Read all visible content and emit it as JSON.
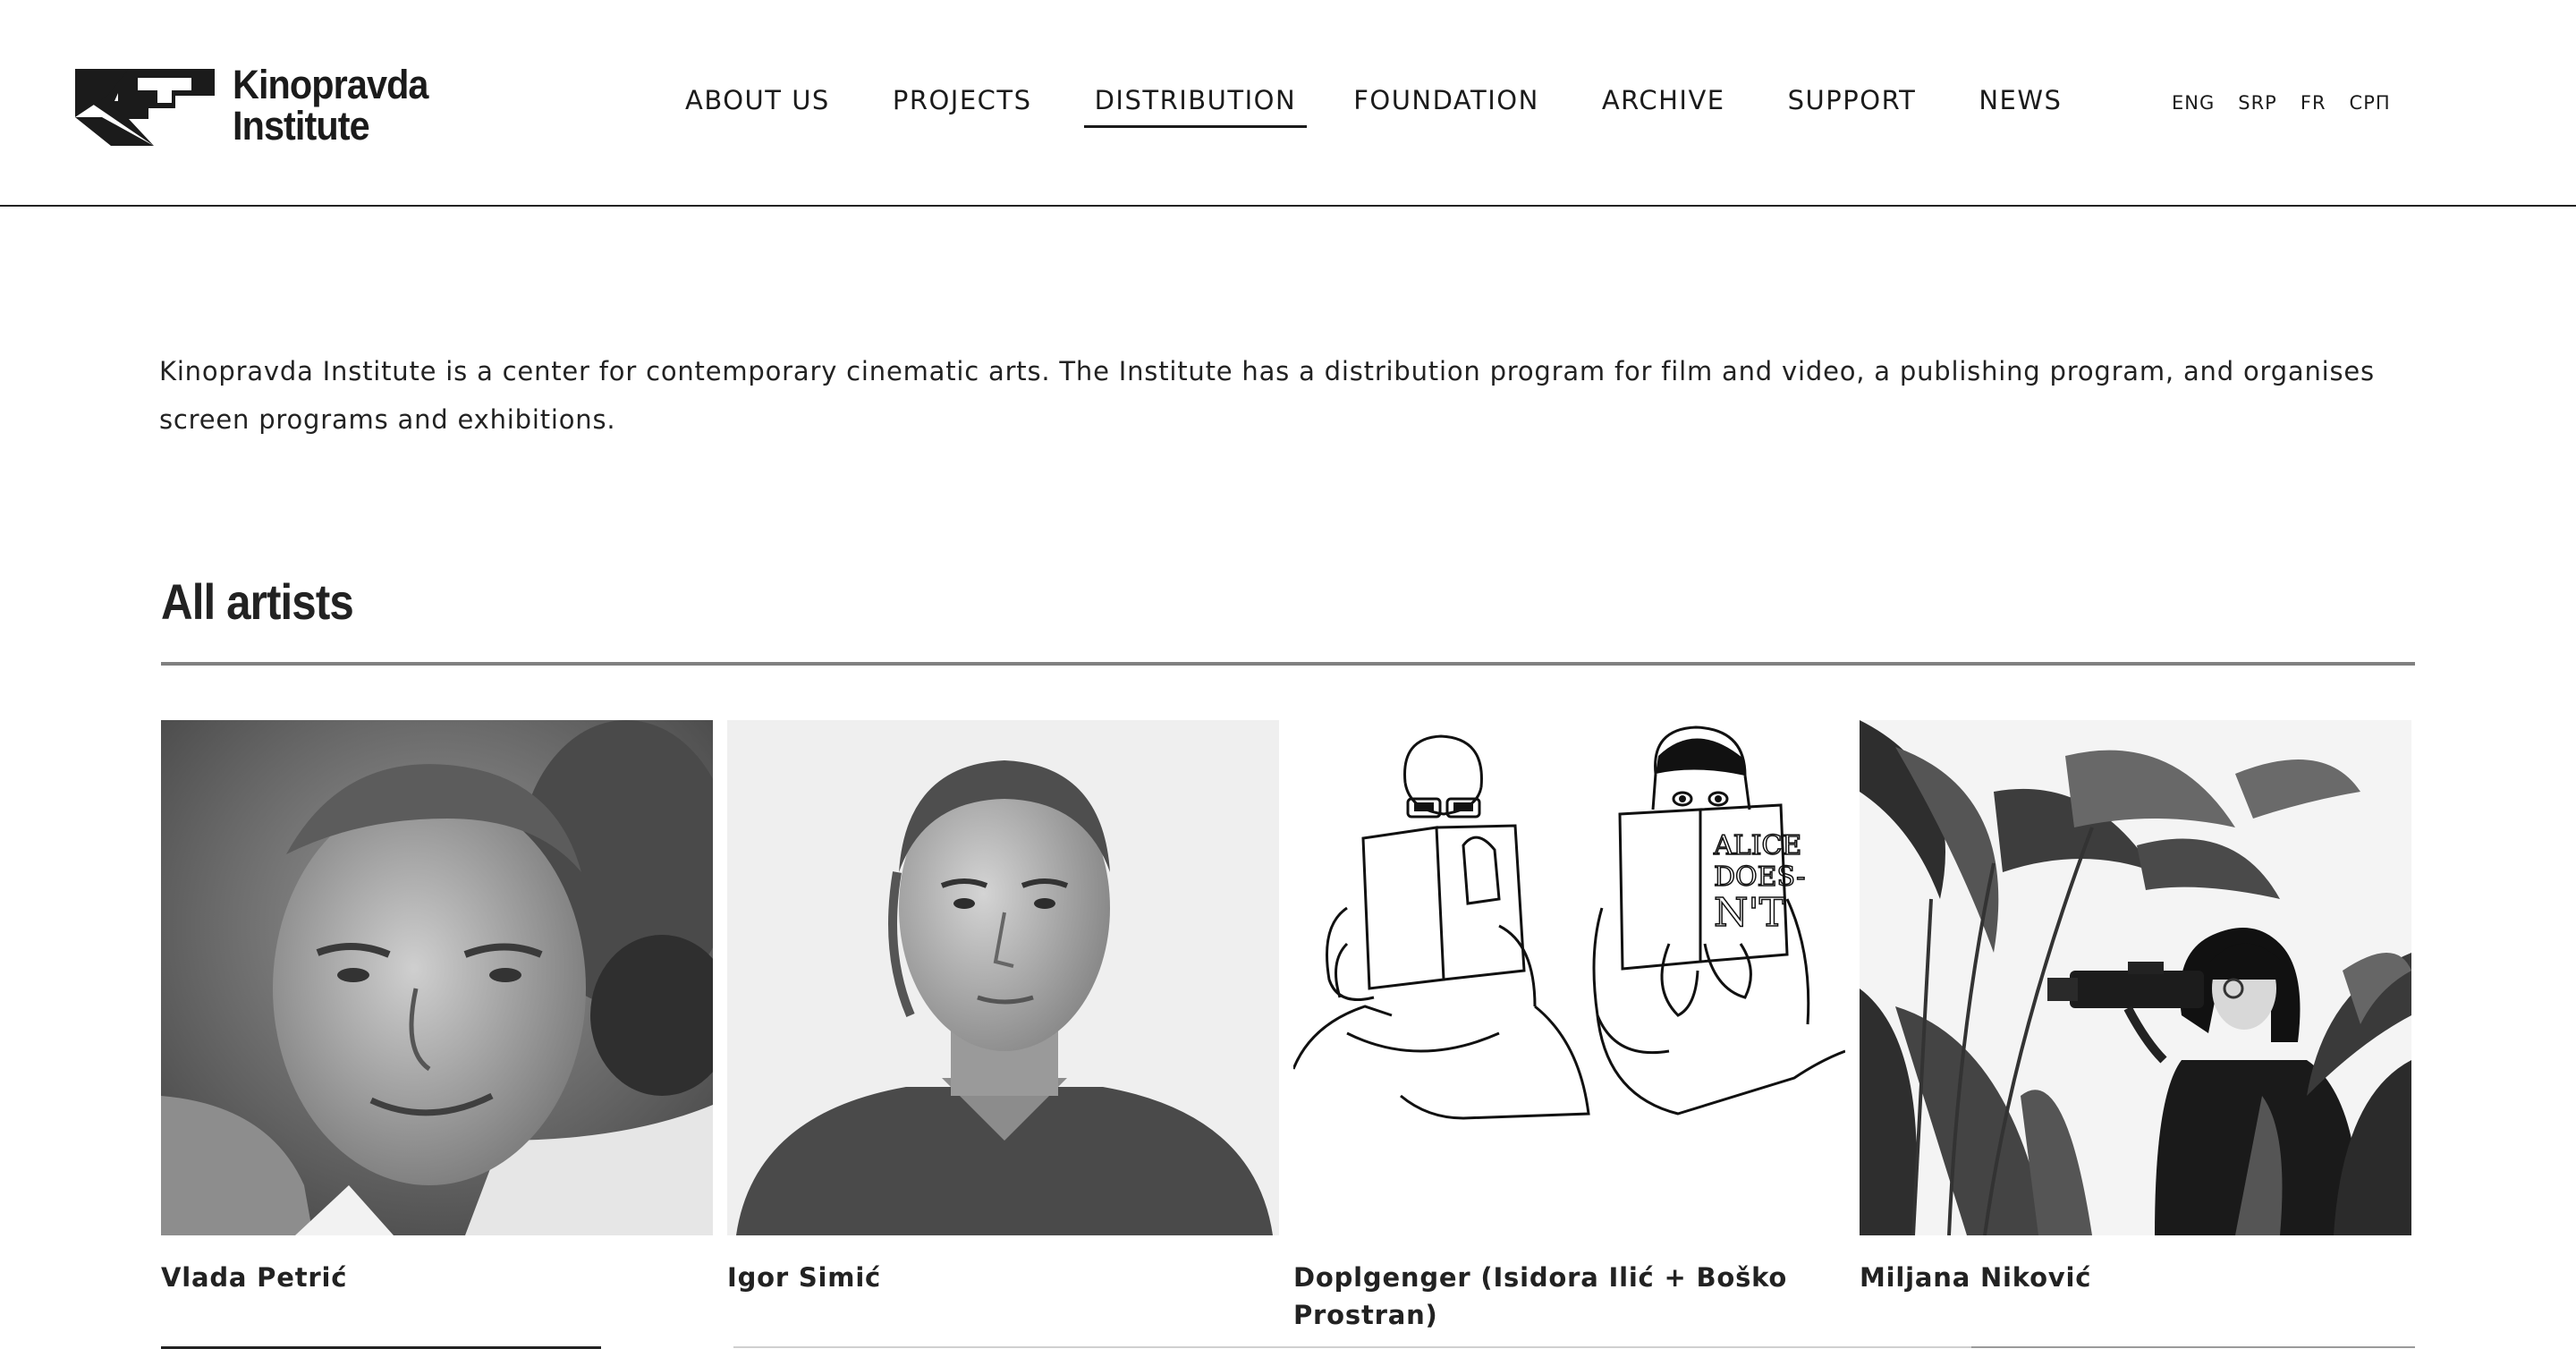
{
  "header": {
    "logo": {
      "line1": "Kinopravda",
      "line2": "Institute",
      "icon": "kinopravda-logo-mark"
    },
    "nav": [
      {
        "label": "ABOUT US",
        "active": false
      },
      {
        "label": "PROJECTS",
        "active": false
      },
      {
        "label": "DISTRIBUTION",
        "active": true
      },
      {
        "label": "FOUNDATION",
        "active": false
      },
      {
        "label": "ARCHIVE",
        "active": false
      },
      {
        "label": "SUPPORT",
        "active": false
      },
      {
        "label": "NEWS",
        "active": false
      }
    ],
    "languages": [
      "ENG",
      "SRP",
      "FR",
      "СРП"
    ]
  },
  "intro": {
    "text": "Kinopravda Institute is a center for contemporary cinematic arts. The Institute has a distribution program for film and video, a publishing program, and organises screen programs and exhibitions."
  },
  "section": {
    "title": "All artists"
  },
  "artists": [
    {
      "name": "Vlada Petrić",
      "image": "portrait-photo-older-man"
    },
    {
      "name": "Igor Simić",
      "image": "portrait-photo-young-man"
    },
    {
      "name": "Doplgenger (Isidora Ilić + Boško Prostran)",
      "image": "line-drawing-two-readers"
    },
    {
      "name": "Miljana Niković",
      "image": "photo-woman-with-camera-among-plants"
    }
  ],
  "colors": {
    "text": "#1b1b1b",
    "rule": "#808080",
    "background": "#ffffff"
  }
}
